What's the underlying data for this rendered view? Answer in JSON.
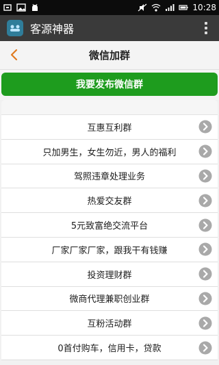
{
  "status_bar": {
    "time": "10:28"
  },
  "app_bar": {
    "title": "客源神器"
  },
  "title_bar": {
    "title": "微信加群"
  },
  "publish_button": {
    "label": "我要发布微信群"
  },
  "list": {
    "items": [
      {
        "label": "互惠互利群"
      },
      {
        "label": "只加男生，女生勿近，男人的福利"
      },
      {
        "label": "驾照违章处理业务"
      },
      {
        "label": "热爱交友群"
      },
      {
        "label": "5元致富绝交流平台"
      },
      {
        "label": "厂家厂家厂家，跟我干有钱赚"
      },
      {
        "label": "投资理财群"
      },
      {
        "label": "微商代理兼职创业群"
      },
      {
        "label": "互粉活动群"
      },
      {
        "label": "0首付购车，信用卡，贷款"
      }
    ]
  },
  "colors": {
    "status_bar": "#0c0c0c",
    "app_bar": "#3a3a3a",
    "publish_button": "#1e9c1e",
    "back_arrow": "#e07a1f",
    "chevron_circle": "#a9a9a9"
  }
}
